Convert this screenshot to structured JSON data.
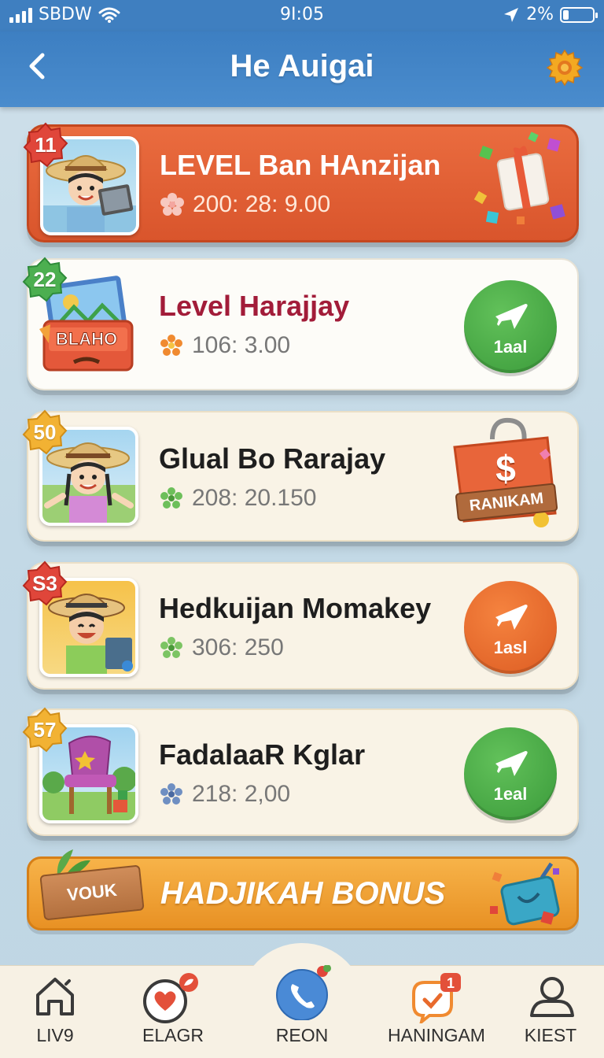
{
  "status_bar": {
    "carrier": "SBDW",
    "time": "9I:05",
    "battery": "2%",
    "battery_level": 0.2
  },
  "header": {
    "title": "He Auigai"
  },
  "cards": [
    {
      "badge": "11",
      "title": "LEVEL Ban  HAnzijan",
      "stat": "200: 28: 9.00",
      "style": "orange"
    },
    {
      "badge": "22",
      "title": "Level Harajjay",
      "stat": "106: 3.00",
      "button": "1aal",
      "thumb_label": "BLAHO"
    },
    {
      "badge": "50",
      "title": "Glual Bo Rarajay",
      "stat": "208: 20.150",
      "tag": "RANIKAM",
      "tag_symbol": "$"
    },
    {
      "badge": "S3",
      "title": "Hedkuijan Momakey",
      "stat": "306: 250",
      "button": "1asl"
    },
    {
      "badge": "57",
      "title": "FadalaaR Kglar",
      "stat": "218: 2,00",
      "button": "1eal"
    }
  ],
  "bonus": {
    "sign": "VOUK",
    "text": "HADJIKAH BONUS"
  },
  "tabs": [
    {
      "label": "LIV9"
    },
    {
      "label": "ELAGR"
    },
    {
      "label": "REON"
    },
    {
      "label": "HANINGAM",
      "badge": "1"
    },
    {
      "label": "KIEST"
    }
  ],
  "colors": {
    "header_blue": "#3d7fc2",
    "card_orange": "#e4643a",
    "button_green": "#45a843",
    "button_orange": "#e86a2c",
    "bonus_orange": "#f0a23a"
  }
}
